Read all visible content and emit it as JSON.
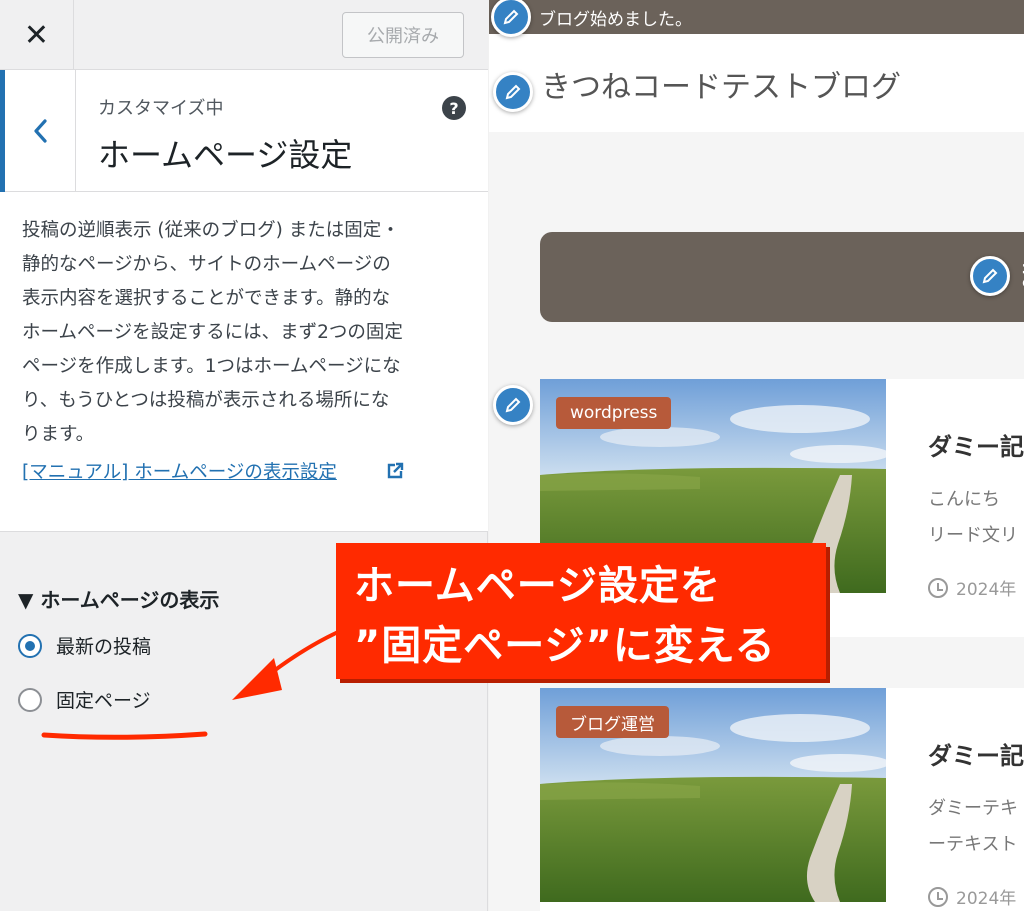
{
  "customizer": {
    "close_icon": "close-icon",
    "publish_label": "公開済み",
    "breadcrumb": "カスタマイズ中",
    "section_title": "ホームページ設定",
    "help_icon": "?",
    "description_lines": [
      "投稿の逆順表示 (従来のブログ) または固定・",
      "静的なページから、サイトのホームページの",
      "表示内容を選択することができます。静的な",
      "ホームページを設定するには、まず2つの固定",
      "ページを作成します。1つはホームページにな",
      "り、もうひとつは投稿が表示される場所にな",
      "ります。"
    ],
    "manual_link": "[マニュアル] ホームページの表示設定",
    "display_heading": "▼ ホームページの表示",
    "options": [
      {
        "label": "最新の投稿",
        "checked": true
      },
      {
        "label": "固定ページ",
        "checked": false
      }
    ]
  },
  "preview": {
    "announcement": "ブログ始めました。",
    "site_title": "きつねコードテストブログ",
    "nav_text": "ま",
    "cards": [
      {
        "tag": "wordpress",
        "title": "ダミー記",
        "line1": "こんにち",
        "line2": "リード文リ",
        "date": "2024年"
      },
      {
        "tag": "ブログ運営",
        "title": "ダミー記",
        "line1": "ダミーテキ",
        "line2": "ーテキスト",
        "date": "2024年"
      }
    ]
  },
  "annotation": {
    "line1": "ホームページ設定を",
    "line2": "”固定ページ”に変える"
  },
  "colors": {
    "accent": "#2271b1",
    "annotation": "#ff2a00",
    "nav_brown": "#6b625a",
    "tag": "#b75a3a"
  }
}
